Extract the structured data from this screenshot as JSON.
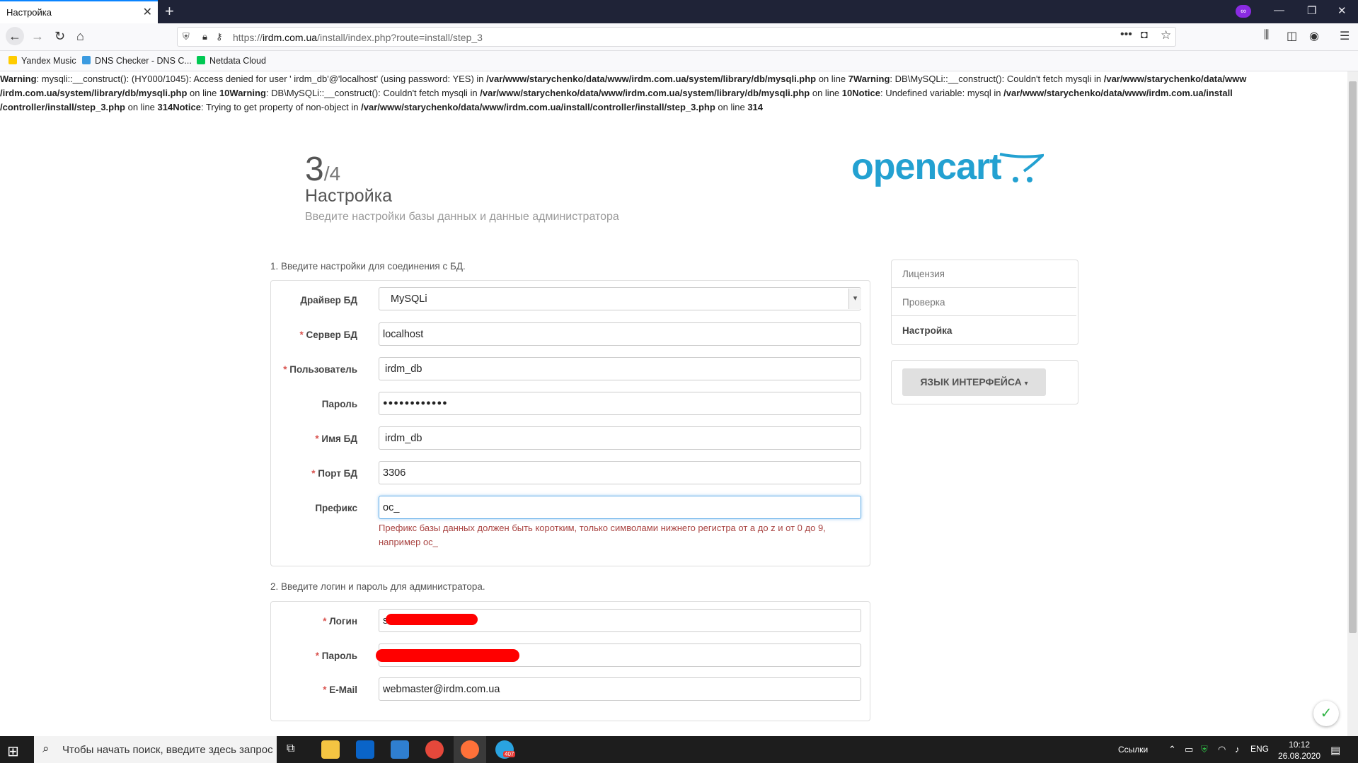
{
  "browser": {
    "tab_title": "Настройка",
    "url_scheme": "https://",
    "url_host": "irdm.com.ua",
    "url_path": "/install/index.php?route=install/step_3",
    "bookmarks": [
      "Yandex Music",
      "DNS Checker - DNS C...",
      "Netdata Cloud"
    ]
  },
  "warnings": {
    "line1_a": "Warning",
    "line1_b": ": mysqli::__construct(): (HY000/1045): Access denied for user ' irdm_db'@'localhost' (using password: YES) in ",
    "line1_c": "/var/www/starychenko/data/www/irdm.com.ua/system/library/db/mysqli.php",
    "line1_d": " on line ",
    "line1_e": "7Warning",
    "line1_f": ": DB\\MySQLi::__construct(): Couldn't fetch mysqli in ",
    "line1_g": "/var/www/starychenko/data/www",
    "line2_a": "/irdm.com.ua/system/library/db/mysqli.php",
    "line2_b": " on line ",
    "line2_c": "10Warning",
    "line2_d": ": DB\\MySQLi::__construct(): Couldn't fetch mysqli in ",
    "line2_e": "/var/www/starychenko/data/www/irdm.com.ua/system/library/db/mysqli.php",
    "line2_f": " on line ",
    "line2_g": "10Notice",
    "line2_h": ": Undefined variable: mysql in ",
    "line2_i": "/var/www/starychenko/data/www/irdm.com.ua/install",
    "line3_a": "/controller/install/step_3.php",
    "line3_b": " on line ",
    "line3_c": "314Notice",
    "line3_d": ": Trying to get property of non-object in ",
    "line3_e": "/var/www/starychenko/data/www/irdm.com.ua/install/controller/install/step_3.php",
    "line3_f": " on line ",
    "line3_g": "314"
  },
  "header": {
    "step_current": "3",
    "step_total": "/4",
    "title": "Настройка",
    "subtitle": "Введите настройки базы данных и данные администратора",
    "logo": "opencart"
  },
  "db_section": {
    "legend": "1. Введите настройки для соединения с БД.",
    "driver_label": "Драйвер БД",
    "driver_value": "MySQLi",
    "host_label": "Сервер БД",
    "host_value": "localhost",
    "user_label": "Пользователь",
    "user_value": "irdm_db",
    "password_label": "Пароль",
    "password_value": "●●●●●●●●●●●●",
    "dbname_label": "Имя БД",
    "dbname_value": "irdm_db",
    "port_label": "Порт БД",
    "port_value": "3306",
    "prefix_label": "Префикс",
    "prefix_value": "oc_",
    "prefix_help_1": "Префикс базы данных должен быть коротким, только символами нижнего регистра от a до z и от 0 до 9,",
    "prefix_help_2": "например oc_"
  },
  "admin_section": {
    "legend": "2. Введите логин и пароль для администратора.",
    "login_label": "Логин",
    "login_value": "s",
    "password_label": "Пароль",
    "email_label": "E-Mail",
    "email_value": "webmaster@irdm.com.ua"
  },
  "sidebar": {
    "items": [
      "Лицензия",
      "Проверка",
      "Настройка"
    ],
    "language_button": "ЯЗЫК ИНТЕРФЕЙСА"
  },
  "taskbar": {
    "search_placeholder": "Чтобы начать поиск, введите здесь запрос",
    "links_label": "Ссылки",
    "language": "ENG",
    "time": "10:12",
    "date": "26.08.2020",
    "telegram_badge": "407"
  },
  "colors": {
    "accent": "#23a1d1",
    "error": "#a94442",
    "required": "#d9534f"
  }
}
